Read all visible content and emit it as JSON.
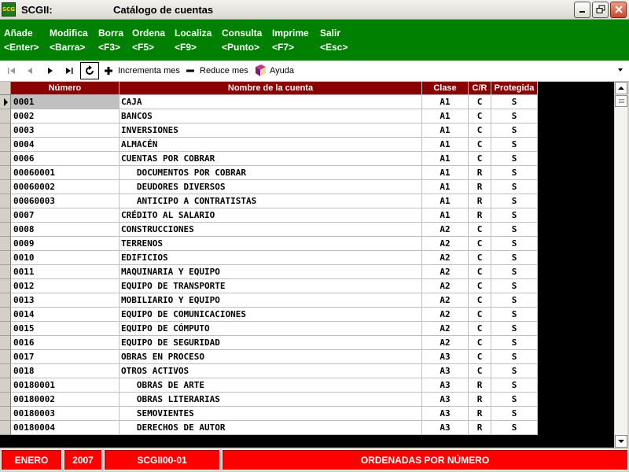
{
  "window": {
    "app_icon_text": "SCG",
    "app_name": "SCGII:",
    "title": "Catálogo de cuentas"
  },
  "menu": [
    {
      "label": "Añade",
      "key": "<Enter>"
    },
    {
      "label": "Modifica",
      "key": "<Barra>"
    },
    {
      "label": "Borra",
      "key": "<F3>"
    },
    {
      "label": "Ordena",
      "key": "<F5>"
    },
    {
      "label": "Localiza",
      "key": "<F9>"
    },
    {
      "label": "Consulta",
      "key": "<Punto>"
    },
    {
      "label": "Imprime",
      "key": "<F7>"
    },
    {
      "label": "Salir",
      "key": "<Esc>"
    }
  ],
  "toolbar": {
    "nav_icons": [
      "first-record-icon",
      "previous-record-icon",
      "next-record-icon",
      "last-record-icon"
    ],
    "refresh_icon": "refresh-icon",
    "increment_label": "Incrementa mes",
    "reduce_label": "Reduce mes",
    "help_label": "Ayuda"
  },
  "table": {
    "columns": [
      "Número",
      "Nombre de la cuenta",
      "Clase",
      "C/R",
      "Protegida"
    ],
    "header_color": "#8b0000",
    "selected_row": 0,
    "rows": [
      {
        "numero": "0001",
        "nombre": "CAJA",
        "clase": "A1",
        "cr": "C",
        "protegida": "S"
      },
      {
        "numero": "0002",
        "nombre": "BANCOS",
        "clase": "A1",
        "cr": "C",
        "protegida": "S"
      },
      {
        "numero": "0003",
        "nombre": "INVERSIONES",
        "clase": "A1",
        "cr": "C",
        "protegida": "S"
      },
      {
        "numero": "0004",
        "nombre": "ALMACÉN",
        "clase": "A1",
        "cr": "C",
        "protegida": "S"
      },
      {
        "numero": "0006",
        "nombre": "CUENTAS POR COBRAR",
        "clase": "A1",
        "cr": "C",
        "protegida": "S"
      },
      {
        "numero": "00060001",
        "nombre": "   DOCUMENTOS POR COBRAR",
        "clase": "A1",
        "cr": "R",
        "protegida": "S"
      },
      {
        "numero": "00060002",
        "nombre": "   DEUDORES DIVERSOS",
        "clase": "A1",
        "cr": "R",
        "protegida": "S"
      },
      {
        "numero": "00060003",
        "nombre": "   ANTICIPO A CONTRATISTAS",
        "clase": "A1",
        "cr": "R",
        "protegida": "S"
      },
      {
        "numero": "0007",
        "nombre": "CRÉDITO AL SALARIO",
        "clase": "A1",
        "cr": "R",
        "protegida": "S"
      },
      {
        "numero": "0008",
        "nombre": "CONSTRUCCIONES",
        "clase": "A2",
        "cr": "C",
        "protegida": "S"
      },
      {
        "numero": "0009",
        "nombre": "TERRENOS",
        "clase": "A2",
        "cr": "C",
        "protegida": "S"
      },
      {
        "numero": "0010",
        "nombre": "EDIFICIOS",
        "clase": "A2",
        "cr": "C",
        "protegida": "S"
      },
      {
        "numero": "0011",
        "nombre": "MAQUINARIA Y EQUIPO",
        "clase": "A2",
        "cr": "C",
        "protegida": "S"
      },
      {
        "numero": "0012",
        "nombre": "EQUIPO DE TRANSPORTE",
        "clase": "A2",
        "cr": "C",
        "protegida": "S"
      },
      {
        "numero": "0013",
        "nombre": "MOBILIARIO Y EQUIPO",
        "clase": "A2",
        "cr": "C",
        "protegida": "S"
      },
      {
        "numero": "0014",
        "nombre": "EQUIPO DE COMUNICACIONES",
        "clase": "A2",
        "cr": "C",
        "protegida": "S"
      },
      {
        "numero": "0015",
        "nombre": "EQUIPO DE CÓMPUTO",
        "clase": "A2",
        "cr": "C",
        "protegida": "S"
      },
      {
        "numero": "0016",
        "nombre": "EQUIPO DE SEGURIDAD",
        "clase": "A2",
        "cr": "C",
        "protegida": "S"
      },
      {
        "numero": "0017",
        "nombre": "OBRAS EN PROCESO",
        "clase": "A3",
        "cr": "C",
        "protegida": "S"
      },
      {
        "numero": "0018",
        "nombre": "OTROS ACTIVOS",
        "clase": "A3",
        "cr": "C",
        "protegida": "S"
      },
      {
        "numero": "00180001",
        "nombre": "   OBRAS DE ARTE",
        "clase": "A3",
        "cr": "R",
        "protegida": "S"
      },
      {
        "numero": "00180002",
        "nombre": "   OBRAS LITERARIAS",
        "clase": "A3",
        "cr": "R",
        "protegida": "S"
      },
      {
        "numero": "00180003",
        "nombre": "   SEMOVIENTES",
        "clase": "A3",
        "cr": "R",
        "protegida": "S"
      },
      {
        "numero": "00180004",
        "nombre": "   DERECHOS DE AUTOR",
        "clase": "A3",
        "cr": "R",
        "protegida": "S"
      }
    ]
  },
  "status": {
    "month": "ENERO",
    "year": "2007",
    "code": "SCGII00-01",
    "order": "ORDENADAS POR NÚMERO",
    "color": "#ff0000"
  }
}
